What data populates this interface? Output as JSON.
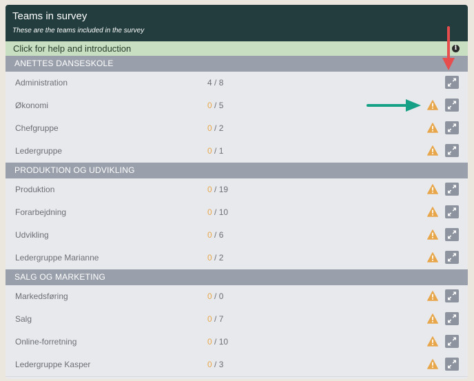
{
  "header": {
    "title": "Teams in survey",
    "subtitle": "These are the teams included in the survey"
  },
  "help": {
    "label": "Click for help and introduction",
    "icon": "info-icon"
  },
  "colors": {
    "header_bg": "#233d3e",
    "help_bg": "#c8e0c1",
    "group_bg": "#9aa0ab",
    "warning": "#e8a64a",
    "button_bg": "#8d949f",
    "annotation_red": "#e84d4d",
    "annotation_teal": "#16a085"
  },
  "groups": [
    {
      "name": "ANETTES DANSESKOLE",
      "teams": [
        {
          "name": "Administration",
          "completed": "4",
          "total": "8",
          "warning": false
        },
        {
          "name": "Økonomi",
          "completed": "0",
          "total": "5",
          "warning": true
        },
        {
          "name": "Chefgruppe",
          "completed": "0",
          "total": "2",
          "warning": true
        },
        {
          "name": "Ledergruppe",
          "completed": "0",
          "total": "1",
          "warning": true
        }
      ]
    },
    {
      "name": "PRODUKTION OG UDVIKLING",
      "teams": [
        {
          "name": "Produktion",
          "completed": "0",
          "total": "19",
          "warning": true
        },
        {
          "name": "Forarbejdning",
          "completed": "0",
          "total": "10",
          "warning": true
        },
        {
          "name": "Udvikling",
          "completed": "0",
          "total": "6",
          "warning": true
        },
        {
          "name": "Ledergruppe Marianne",
          "completed": "0",
          "total": "2",
          "warning": true
        }
      ]
    },
    {
      "name": "SALG OG MARKETING",
      "teams": [
        {
          "name": "Markedsføring",
          "completed": "0",
          "total": "0",
          "warning": true
        },
        {
          "name": "Salg",
          "completed": "0",
          "total": "7",
          "warning": true
        },
        {
          "name": "Online-forretning",
          "completed": "0",
          "total": "10",
          "warning": true
        },
        {
          "name": "Ledergruppe Kasper",
          "completed": "0",
          "total": "3",
          "warning": true
        }
      ]
    }
  ],
  "annotations": [
    {
      "type": "arrow",
      "direction": "down",
      "color": "annotation_red",
      "points_to": "expand-button"
    },
    {
      "type": "arrow",
      "direction": "right",
      "color": "annotation_teal",
      "points_to": "warning-icon"
    }
  ]
}
